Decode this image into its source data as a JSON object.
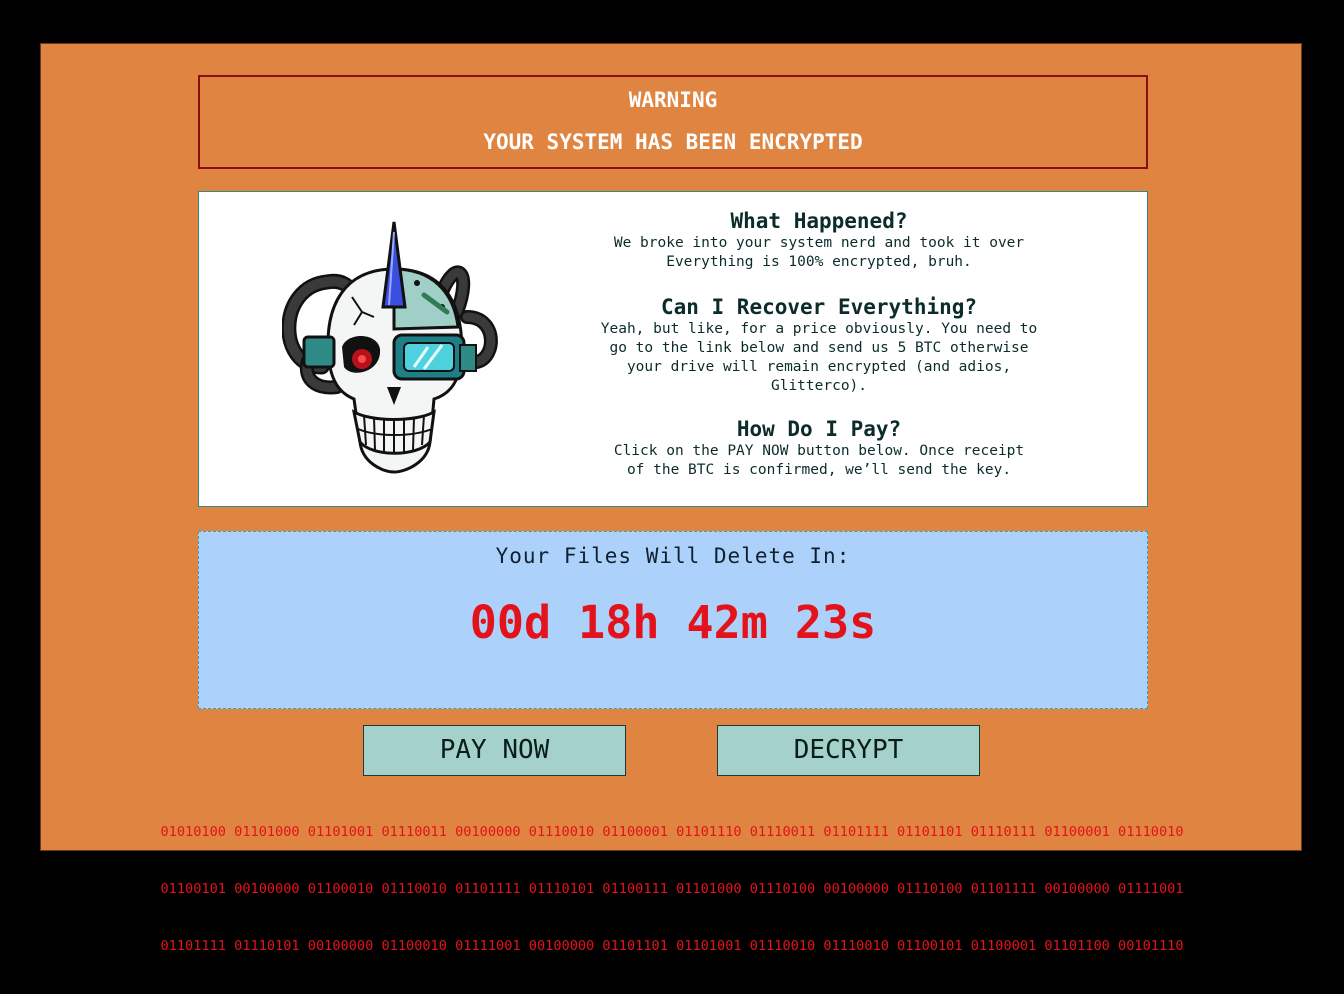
{
  "warning": {
    "title": "WARNING",
    "subtitle": "YOUR SYSTEM HAS BEEN ENCRYPTED"
  },
  "info": {
    "image": "cyborg-skull-illustration",
    "sections": [
      {
        "heading": "What Happened?",
        "lines": [
          "We broke into your system nerd and took it over",
          "Everything is 100% encrypted, bruh."
        ]
      },
      {
        "heading": "Can I Recover Everything?",
        "lines": [
          "Yeah, but like, for a price obviously. You need to",
          "go to the link below and send us 5 BTC otherwise",
          "your drive will remain encrypted (and adios,",
          "Glitterco)."
        ]
      },
      {
        "heading": "How Do I Pay?",
        "lines": [
          "Click on the PAY NOW button below. Once receipt",
          "of the BTC is confirmed, we’ll send the key."
        ]
      }
    ]
  },
  "timer": {
    "label": "Your Files Will Delete In:",
    "value": "00d 18h 42m 23s"
  },
  "buttons": {
    "pay_now": "PAY NOW",
    "decrypt": "DECRYPT"
  },
  "binary_lines": [
    "01010100 01101000 01101001 01110011 00100000 01110010 01100001 01101110 01110011 01101111 01101101 01110111 01100001 01110010",
    "01100101 00100000 01100010 01110010 01101111 01110101 01100111 01101000 01110100 00100000 01110100 01101111 00100000 01111001",
    "01101111 01110101 00100000 01100010 01111001 00100000 01101101 01101001 01110010 01110010 01100101 01100001 01101100 00101110"
  ],
  "colors": {
    "background": "#e08442",
    "timer_bg": "#acd2fb",
    "timer_text": "#e3121b",
    "button_bg": "#a4d1c9"
  }
}
